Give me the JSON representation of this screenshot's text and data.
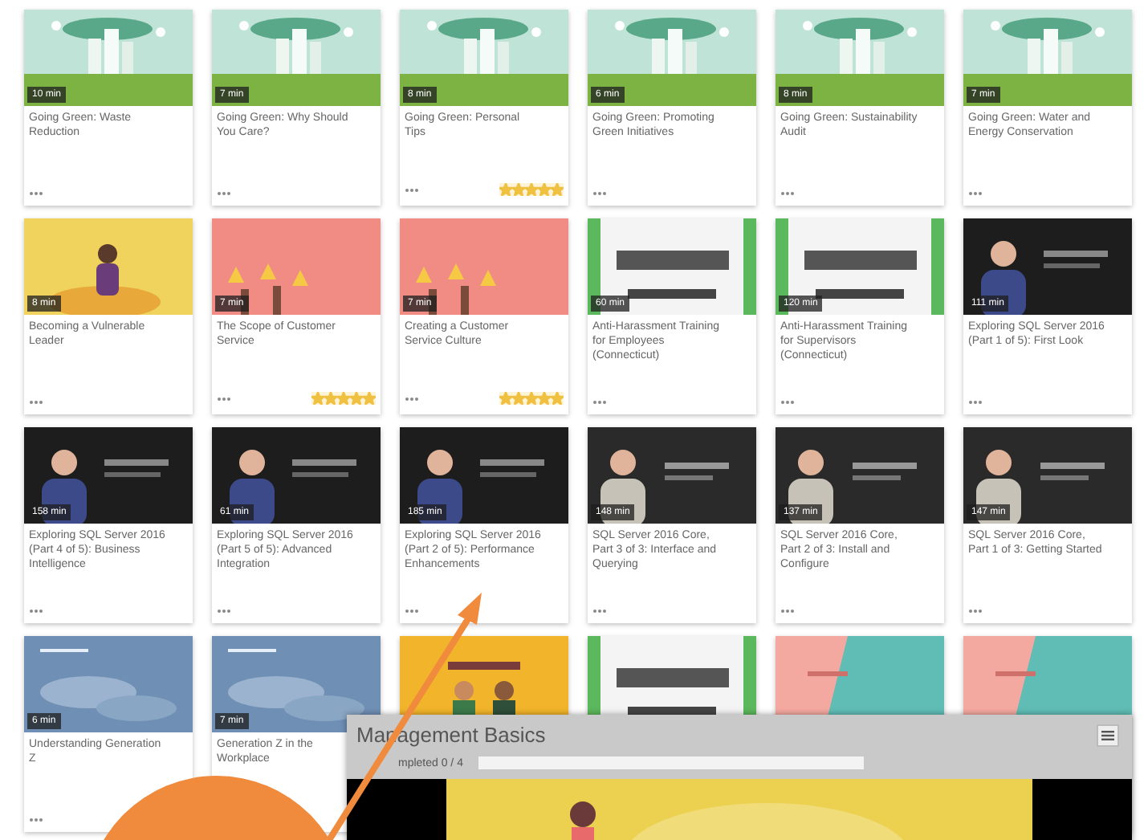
{
  "courses": [
    {
      "kind": "course",
      "duration": "10 min",
      "title": "Going Green: Waste Reduction"
    },
    {
      "kind": "course",
      "duration": "7 min",
      "title": "Going Green: Why Should You Care?"
    },
    {
      "kind": "course",
      "duration": "8 min",
      "title": "Going Green: Personal Tips",
      "stars": 5
    },
    {
      "kind": "course",
      "duration": "6 min",
      "title": "Going Green: Promoting Green Initiatives"
    },
    {
      "kind": "course",
      "duration": "8 min",
      "title": "Going Green: Sustainability Audit"
    },
    {
      "kind": "course",
      "duration": "7 min",
      "title": "Going Green: Water and Energy Conservation"
    },
    {
      "kind": "course",
      "duration": "8 min",
      "title": "Becoming a Vulnerable Leader"
    },
    {
      "kind": "course",
      "duration": "7 min",
      "title": "The Scope of Customer Service",
      "stars": 5
    },
    {
      "kind": "course",
      "duration": "7 min",
      "title": "Creating a Customer Service Culture",
      "stars": 5
    },
    {
      "kind": "course",
      "duration": "60 min",
      "title": "Anti-Harassment Training for Employees (Connecticut)"
    },
    {
      "kind": "course",
      "duration": "120 min",
      "title": "Anti-Harassment Training for Supervisors (Connecticut)"
    },
    {
      "kind": "course",
      "duration": "111 min",
      "title": "Exploring SQL Server 2016 (Part 1 of 5): First Look"
    },
    {
      "kind": "course",
      "duration": "158 min",
      "title": "Exploring SQL Server 2016 (Part 4 of 5): Business Intelligence"
    },
    {
      "kind": "course",
      "duration": "61 min",
      "title": "Exploring SQL Server 2016 (Part 5 of 5): Advanced Integration"
    },
    {
      "kind": "course",
      "duration": "185 min",
      "title": "Exploring SQL Server 2016 (Part 2 of 5): Performance Enhancements"
    },
    {
      "kind": "course",
      "duration": "148 min",
      "title": "SQL Server 2016 Core, Part 3 of 3: Interface and Querying"
    },
    {
      "kind": "course",
      "duration": "137 min",
      "title": "SQL Server 2016 Core, Part 2 of 3: Install and Configure"
    },
    {
      "kind": "course",
      "duration": "147 min",
      "title": "SQL Server 2016 Core, Part 1 of 3: Getting Started"
    },
    {
      "kind": "course",
      "duration": "6 min",
      "title": "Understanding Generation Z"
    },
    {
      "kind": "course",
      "duration": "7 min",
      "title": "Generation Z in the Workplace"
    },
    {
      "kind": "picture"
    },
    {
      "kind": "picture"
    },
    {
      "kind": "picture"
    },
    {
      "kind": "picture"
    }
  ],
  "player": {
    "title": "Management Basics",
    "progress_text": "mpleted 0 / 4",
    "level": 0
  }
}
